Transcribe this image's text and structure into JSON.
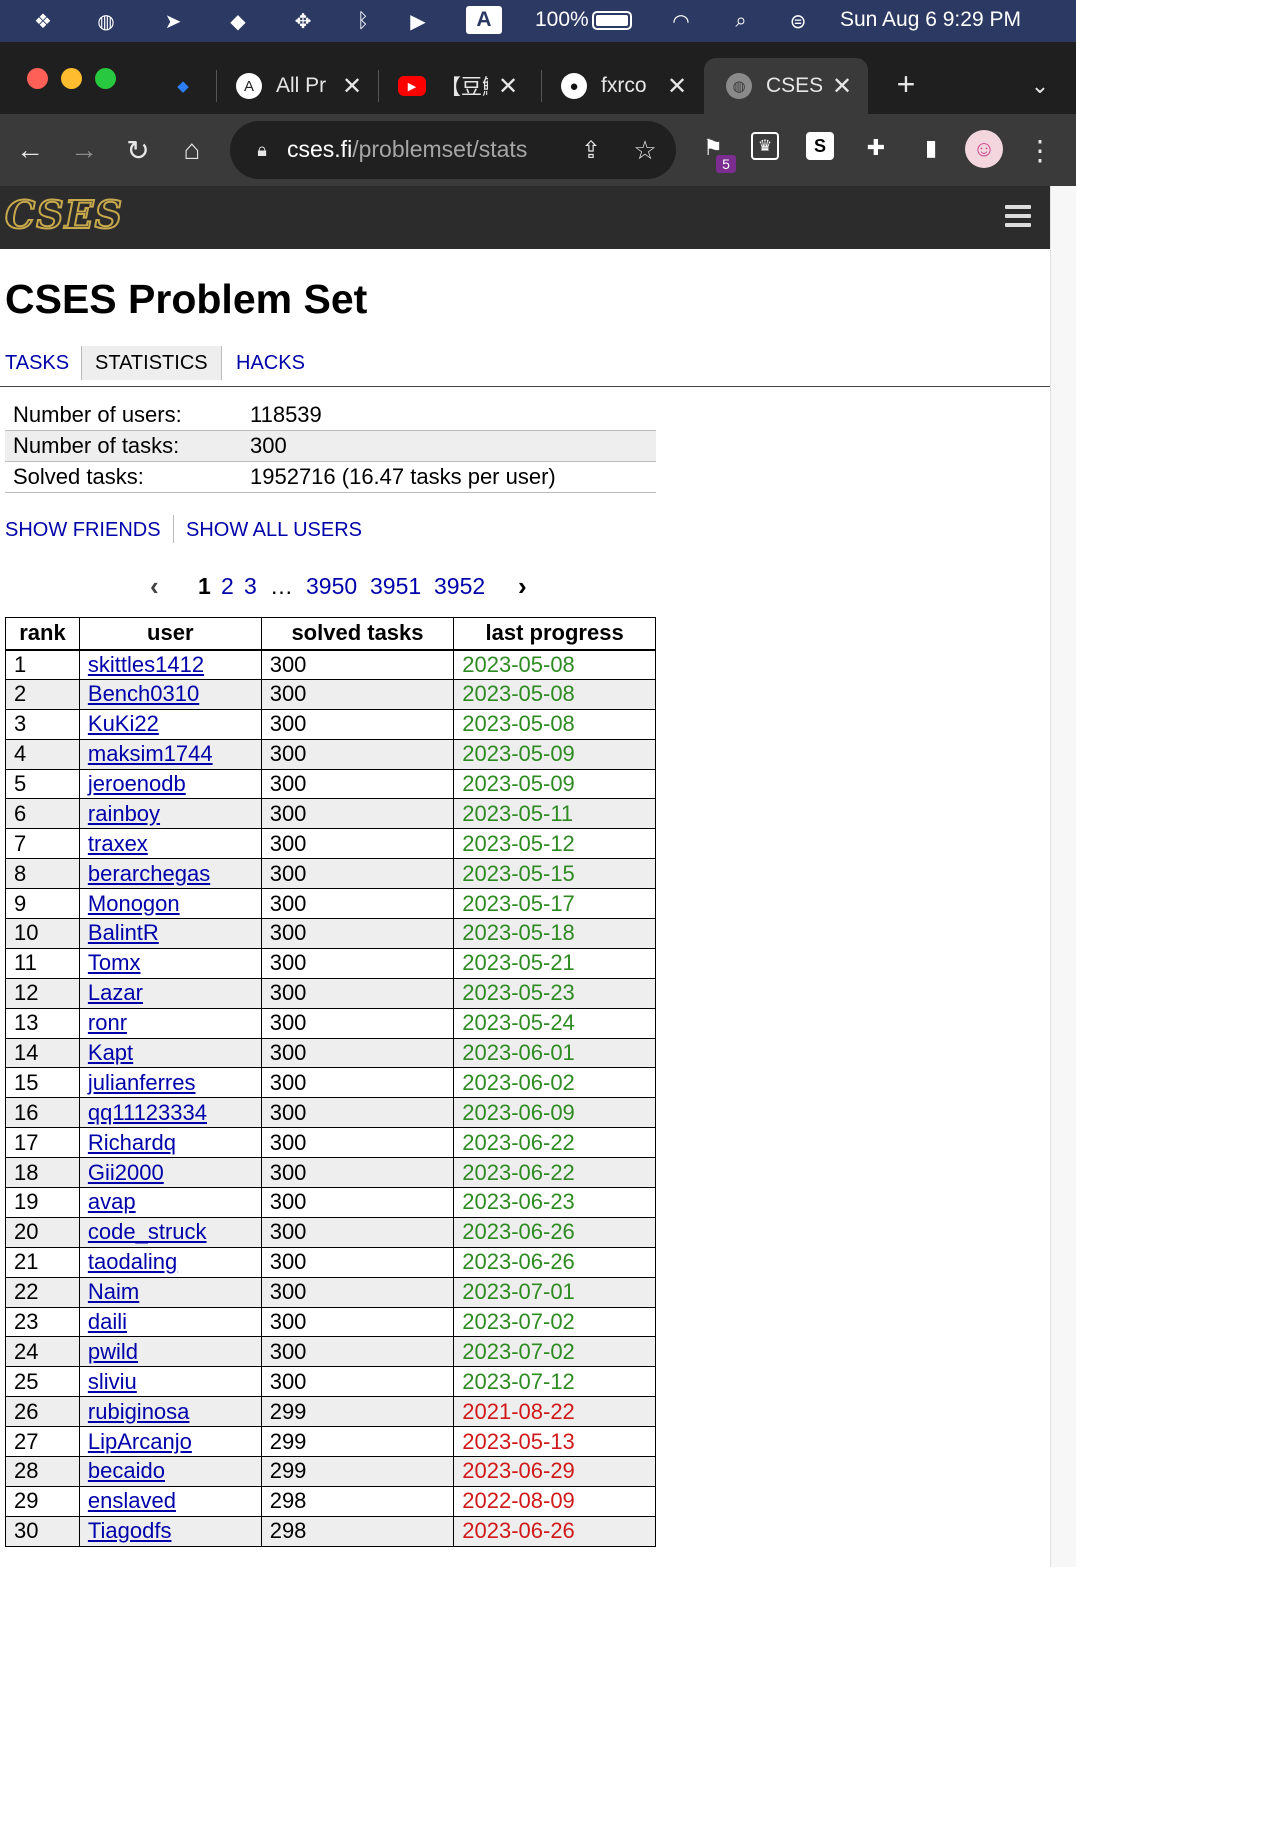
{
  "menubar": {
    "battery": "100%",
    "input_source": "A",
    "datetime": "Sun Aug 6  9:29 PM"
  },
  "tabs": [
    {
      "title": "",
      "icon": "diamond-icon"
    },
    {
      "title": "All Pr",
      "icon": "atcoder-icon"
    },
    {
      "title": "【豆鮞",
      "icon": "youtube-icon"
    },
    {
      "title": "fxrco",
      "icon": "github-icon"
    },
    {
      "title": "CSES",
      "icon": "globe-icon",
      "active": true
    }
  ],
  "toolbar": {
    "url_host": "cses.fi",
    "url_path": "/problemset/stats",
    "extension_badge": "5"
  },
  "site": {
    "logo_text": "CSES",
    "page_title": "CSES Problem Set",
    "nav": [
      {
        "label": "TASKS",
        "current": false
      },
      {
        "label": "STATISTICS",
        "current": true
      },
      {
        "label": "HACKS",
        "current": false
      }
    ]
  },
  "stats": [
    {
      "label": "Number of users:",
      "value": "118539"
    },
    {
      "label": "Number of tasks:",
      "value": "300"
    },
    {
      "label": "Solved tasks:",
      "value": "1952716 (16.47 tasks per user)"
    }
  ],
  "filters": {
    "show_friends": "SHOW FRIENDS",
    "show_all_users": "SHOW ALL USERS"
  },
  "pager": {
    "prev": "‹",
    "pages": [
      "1",
      "2",
      "3",
      "…",
      "3950",
      "3951",
      "3952"
    ],
    "current": "1",
    "next": "›"
  },
  "table": {
    "headers": [
      "rank",
      "user",
      "solved tasks",
      "last progress"
    ],
    "rows": [
      {
        "rank": "1",
        "user": "skittles1412",
        "solved": "300",
        "last": "2023-05-08"
      },
      {
        "rank": "2",
        "user": "Bench0310",
        "solved": "300",
        "last": "2023-05-08"
      },
      {
        "rank": "3",
        "user": "KuKi22",
        "solved": "300",
        "last": "2023-05-08"
      },
      {
        "rank": "4",
        "user": "maksim1744",
        "solved": "300",
        "last": "2023-05-09"
      },
      {
        "rank": "5",
        "user": "jeroenodb",
        "solved": "300",
        "last": "2023-05-09"
      },
      {
        "rank": "6",
        "user": "rainboy",
        "solved": "300",
        "last": "2023-05-11"
      },
      {
        "rank": "7",
        "user": "traxex",
        "solved": "300",
        "last": "2023-05-12"
      },
      {
        "rank": "8",
        "user": "berarchegas",
        "solved": "300",
        "last": "2023-05-15"
      },
      {
        "rank": "9",
        "user": "Monogon",
        "solved": "300",
        "last": "2023-05-17"
      },
      {
        "rank": "10",
        "user": "BalintR",
        "solved": "300",
        "last": "2023-05-18"
      },
      {
        "rank": "11",
        "user": "Tomx",
        "solved": "300",
        "last": "2023-05-21"
      },
      {
        "rank": "12",
        "user": "Lazar",
        "solved": "300",
        "last": "2023-05-23"
      },
      {
        "rank": "13",
        "user": "ronr",
        "solved": "300",
        "last": "2023-05-24"
      },
      {
        "rank": "14",
        "user": "Kapt",
        "solved": "300",
        "last": "2023-06-01"
      },
      {
        "rank": "15",
        "user": "julianferres",
        "solved": "300",
        "last": "2023-06-02"
      },
      {
        "rank": "16",
        "user": "qq11123334",
        "solved": "300",
        "last": "2023-06-09"
      },
      {
        "rank": "17",
        "user": "Richardq",
        "solved": "300",
        "last": "2023-06-22"
      },
      {
        "rank": "18",
        "user": "Gii2000",
        "solved": "300",
        "last": "2023-06-22"
      },
      {
        "rank": "19",
        "user": "avap",
        "solved": "300",
        "last": "2023-06-23"
      },
      {
        "rank": "20",
        "user": "code_struck",
        "solved": "300",
        "last": "2023-06-26"
      },
      {
        "rank": "21",
        "user": "taodaling",
        "solved": "300",
        "last": "2023-06-26"
      },
      {
        "rank": "22",
        "user": "Naim",
        "solved": "300",
        "last": "2023-07-01"
      },
      {
        "rank": "23",
        "user": "daili",
        "solved": "300",
        "last": "2023-07-02"
      },
      {
        "rank": "24",
        "user": "pwild",
        "solved": "300",
        "last": "2023-07-02"
      },
      {
        "rank": "25",
        "user": "sliviu",
        "solved": "300",
        "last": "2023-07-12"
      },
      {
        "rank": "26",
        "user": "rubiginosa",
        "solved": "299",
        "last": "2021-08-22"
      },
      {
        "rank": "27",
        "user": "LipArcanjo",
        "solved": "299",
        "last": "2023-05-13"
      },
      {
        "rank": "28",
        "user": "becaido",
        "solved": "299",
        "last": "2023-06-29"
      },
      {
        "rank": "29",
        "user": "enslaved",
        "solved": "298",
        "last": "2022-08-09"
      },
      {
        "rank": "30",
        "user": "Tiagodfs",
        "solved": "298",
        "last": "2023-06-26"
      }
    ]
  },
  "colors": {
    "link": "#0000aa",
    "complete_progress": "#2e8b22",
    "partial_progress": "#d01a1a",
    "header_bg": "#2c2c2c",
    "logo_gold": "#c7a94c"
  }
}
